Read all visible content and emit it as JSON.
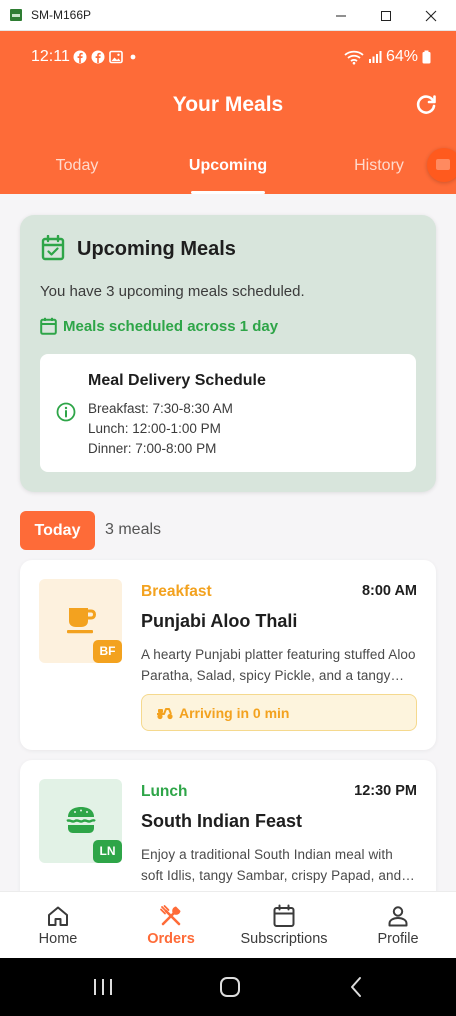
{
  "window": {
    "title": "SM-M166P"
  },
  "status_bar": {
    "time": "12:11",
    "battery": "64%"
  },
  "header": {
    "title": "Your Meals"
  },
  "tabs": [
    {
      "label": "Today"
    },
    {
      "label": "Upcoming",
      "active": true
    },
    {
      "label": "History"
    }
  ],
  "upcoming": {
    "title": "Upcoming Meals",
    "description": "You have 3 upcoming meals scheduled.",
    "scheduled_text": "Meals scheduled across 1 day",
    "schedule": {
      "title": "Meal Delivery Schedule",
      "lines": [
        "Breakfast: 7:30-8:30 AM",
        "Lunch: 12:00-1:00 PM",
        "Dinner: 7:00-8:00 PM"
      ]
    }
  },
  "day_group": {
    "label": "Today",
    "count": "3 meals"
  },
  "meals": [
    {
      "type": "Breakfast",
      "time": "8:00 AM",
      "name": "Punjabi Aloo Thali",
      "description": "A hearty Punjabi platter featuring stuffed Aloo Paratha, Salad, spicy Pickle, and a tangy side.",
      "code": "BF",
      "icon": "coffee-cup-icon",
      "status": "Arriving in 0 min"
    },
    {
      "type": "Lunch",
      "time": "12:30 PM",
      "name": "South Indian Feast",
      "description": "Enjoy a traditional South Indian meal with soft Idlis, tangy Sambar, crispy Papad, and more.",
      "code": "LN",
      "icon": "burger-icon"
    }
  ],
  "bottom_nav": [
    {
      "label": "Home",
      "icon": "home-icon"
    },
    {
      "label": "Orders",
      "icon": "orders-icon",
      "active": true
    },
    {
      "label": "Subscriptions",
      "icon": "calendar-icon"
    },
    {
      "label": "Profile",
      "icon": "person-icon"
    }
  ],
  "colors": {
    "primary": "#fe6b38",
    "success": "#2ea548",
    "breakfast": "#f3a21f",
    "upcoming_bg": "#d8e5dc"
  }
}
